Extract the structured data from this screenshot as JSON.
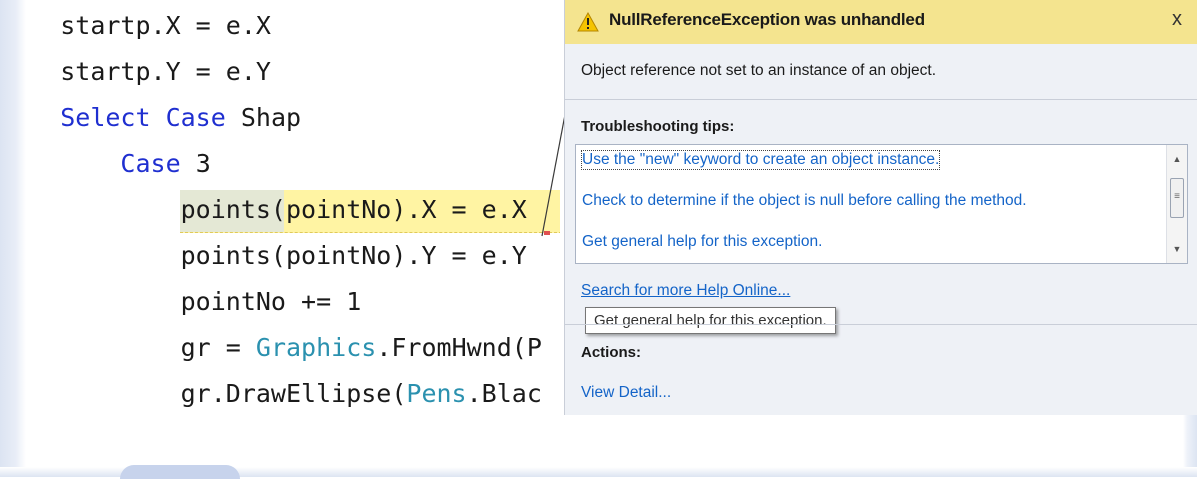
{
  "code_editor": {
    "lines": [
      {
        "indent": "    ",
        "text": "startp.X = e.X"
      },
      {
        "indent": "    ",
        "text": "startp.Y = e.Y"
      },
      {
        "indent": "    ",
        "kw1": "Select Case",
        "text": " Shap"
      },
      {
        "indent": "        ",
        "kw1": "Case",
        "text": " 3"
      },
      {
        "indent": "            ",
        "text": "points(pointNo).X = e.X"
      },
      {
        "indent": "            ",
        "text": "points(pointNo).Y = e.Y"
      },
      {
        "indent": "            ",
        "text": "pointNo += 1"
      },
      {
        "indent": "            ",
        "pre": "gr = ",
        "type": "Graphics",
        "text": ".FromHwnd(P"
      },
      {
        "indent": "            ",
        "pre": "gr.DrawEllipse(",
        "type": "Pens",
        "text": ".Blac"
      }
    ]
  },
  "exception_assistant": {
    "title": "NullReferenceException was unhandled",
    "close_label": "x",
    "message": "Object reference not set to an instance of an object.",
    "troubleshooting_title": "Troubleshooting tips:",
    "tips": [
      "Use the \"new\" keyword to create an object instance.",
      "Check to determine if the object is null before calling the method.",
      "Get general help for this exception."
    ],
    "search_link": "Search for more Help Online...",
    "tooltip": "Get general help for this exception.",
    "actions_title": "Actions:",
    "view_detail": "View Detail..."
  },
  "colors": {
    "header_bg": "#f4e48f",
    "link": "#1464c8",
    "keyword": "#1f2fd0",
    "type": "#2b91af",
    "current_line": "#fff4a3"
  },
  "icons": [
    "warning-icon",
    "scroll-up-arrow-icon",
    "scroll-down-arrow-icon",
    "scroll-grip-icon"
  ]
}
